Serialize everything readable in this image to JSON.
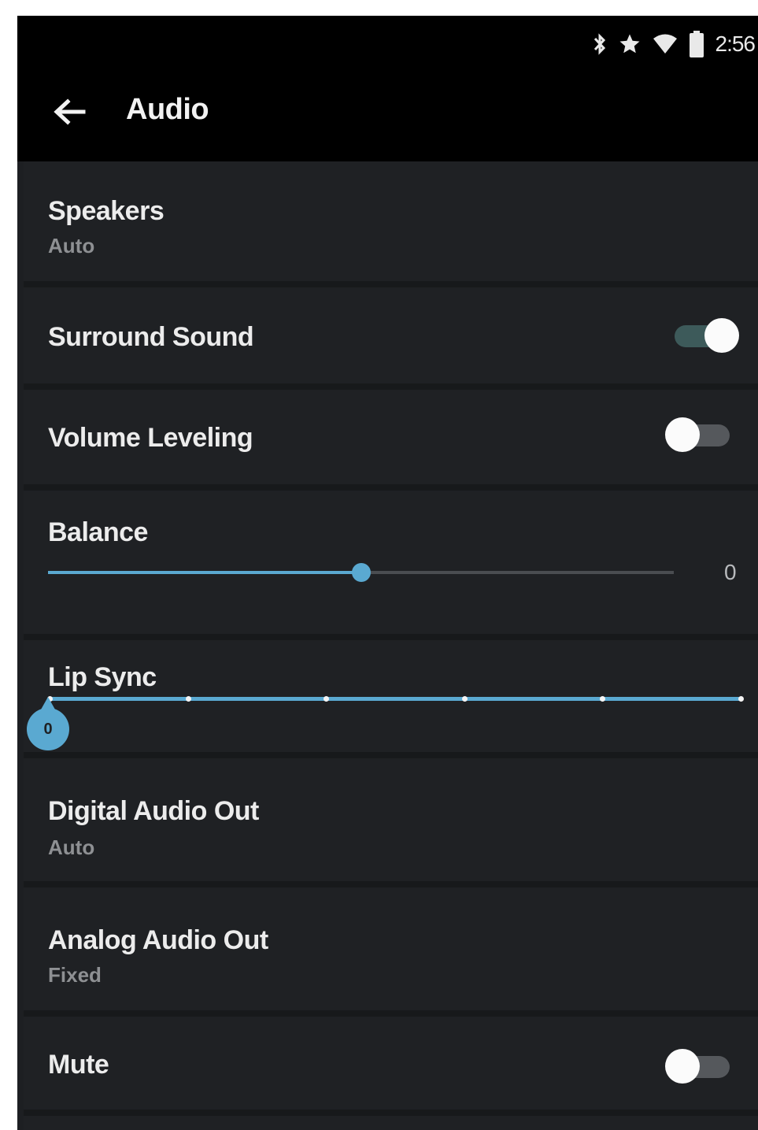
{
  "status_bar": {
    "icons": [
      "bluetooth-icon",
      "star-icon",
      "wifi-icon",
      "battery-icon"
    ],
    "time": "2:56"
  },
  "header": {
    "back_icon": "arrow-left-icon",
    "title": "Audio"
  },
  "settings": {
    "speakers": {
      "label": "Speakers",
      "value": "Auto"
    },
    "surround_sound": {
      "label": "Surround Sound",
      "enabled": true
    },
    "volume_leveling": {
      "label": "Volume Leveling",
      "enabled": false
    },
    "balance": {
      "label": "Balance",
      "value": "0",
      "level_fraction": 0.5
    },
    "lip_sync": {
      "label": "Lip Sync",
      "value": "0",
      "steps": 6
    },
    "digital_audio_out": {
      "label": "Digital Audio Out",
      "value": "Auto"
    },
    "analog_audio_out": {
      "label": "Analog Audio Out",
      "value": "Fixed"
    },
    "mute": {
      "label": "Mute",
      "enabled": false
    }
  },
  "colors": {
    "accent": "#5aa9d1",
    "toggle_on_track": "#3d5a5a",
    "toggle_off_track": "#55585c",
    "background": "#1f2124",
    "appbar": "#000000"
  }
}
